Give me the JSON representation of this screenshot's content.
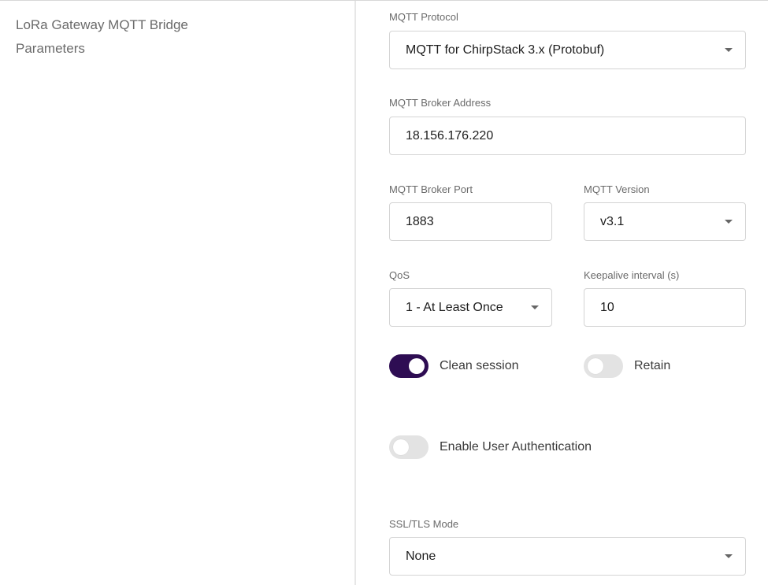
{
  "section": {
    "title": "LoRa Gateway MQTT Bridge Parameters"
  },
  "mqtt_protocol": {
    "label": "MQTT Protocol",
    "value": "MQTT for ChirpStack 3.x (Protobuf)"
  },
  "broker_address": {
    "label": "MQTT Broker Address",
    "value": "18.156.176.220"
  },
  "broker_port": {
    "label": "MQTT Broker Port",
    "value": "1883"
  },
  "mqtt_version": {
    "label": "MQTT Version",
    "value": "v3.1"
  },
  "qos": {
    "label": "QoS",
    "value": "1 - At Least Once"
  },
  "keepalive": {
    "label": "Keepalive interval (s)",
    "value": "10"
  },
  "clean_session": {
    "label": "Clean session",
    "enabled": true
  },
  "retain": {
    "label": "Retain",
    "enabled": false
  },
  "user_auth": {
    "label": "Enable User Authentication",
    "enabled": false
  },
  "ssl_mode": {
    "label": "SSL/TLS Mode",
    "value": "None"
  },
  "colors": {
    "toggle_on": "#2e0d53",
    "toggle_off": "#e3e3e3"
  },
  "icons": {
    "dropdown": "chevron-down-icon"
  }
}
